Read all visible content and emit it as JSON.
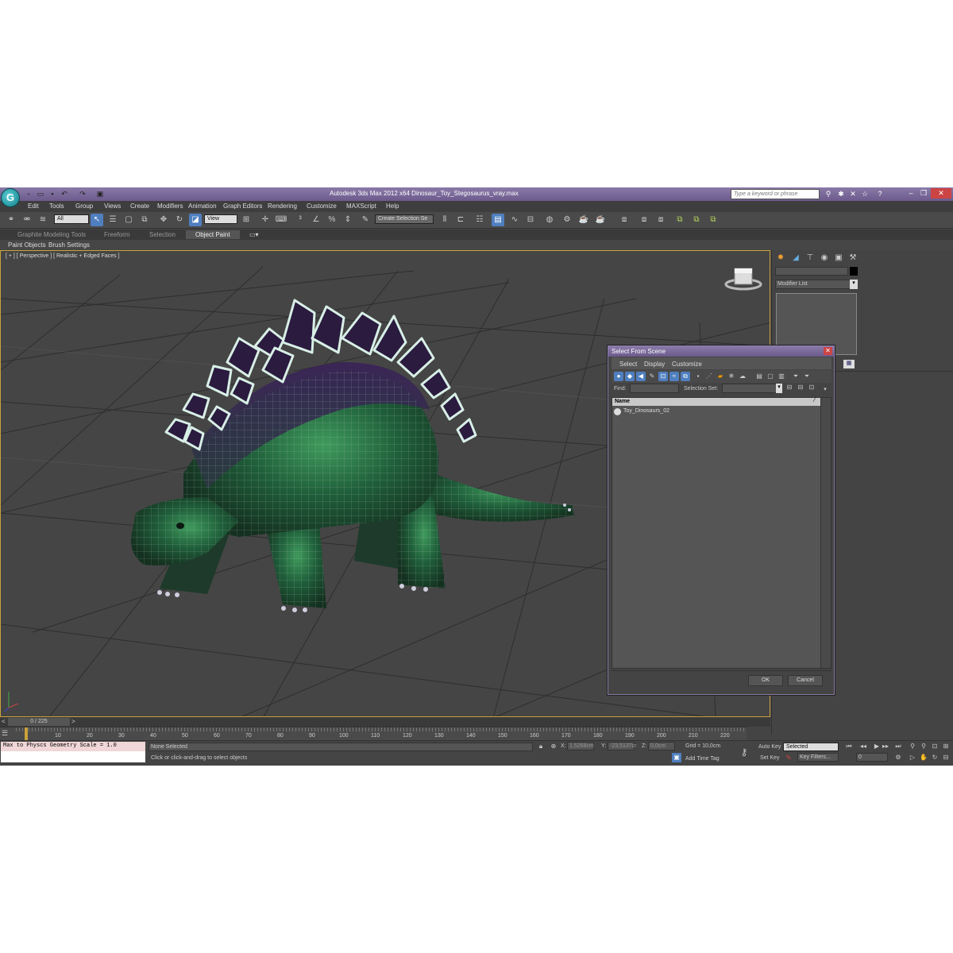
{
  "titlebar": {
    "app_title": "Autodesk 3ds Max  2012 x64     Dinosaur_Toy_Stegosaurus_vray.max",
    "search_placeholder": "Type a keyword or phrase"
  },
  "menu": [
    "Edit",
    "Tools",
    "Group",
    "Views",
    "Create",
    "Modifiers",
    "Animation",
    "Graph Editors",
    "Rendering",
    "Customize",
    "MAXScript",
    "Help"
  ],
  "toolbar": {
    "filter_value": "All",
    "ref_coord_value": "View",
    "selection_set_placeholder": "Create Selection Se"
  },
  "ribbon": {
    "tabs": [
      "Graphite Modeling Tools",
      "Freeform",
      "Selection",
      "Object Paint"
    ],
    "subtabs": [
      "Paint Objects",
      "Brush Settings"
    ]
  },
  "viewport": {
    "label": "[ + ] [ Perspective ] [ Realistic + Edged Faces ]"
  },
  "command_panel": {
    "modifier_list": "Modifier List"
  },
  "dialog": {
    "title": "Select From Scene",
    "menus": [
      "Select",
      "Display",
      "Customize"
    ],
    "find_label": "Find:",
    "selection_set_label": "Selection Set:",
    "column_name": "Name",
    "items": [
      "Toy_Dinosaurs_02"
    ],
    "ok": "OK",
    "cancel": "Cancel"
  },
  "timeline": {
    "frame": "0 / 225",
    "ticks": [
      "10",
      "20",
      "30",
      "40",
      "50",
      "60",
      "70",
      "80",
      "90",
      "100",
      "110",
      "120",
      "130",
      "140",
      "150",
      "160",
      "170",
      "180",
      "190",
      "200",
      "210",
      "220"
    ]
  },
  "status": {
    "maxscript_line": "Max to Physcs Geometry Scale = 1.0",
    "selection": "None Selected",
    "prompt": "Click or click-and-drag to select objects",
    "x_label": "X:",
    "x_value": "1,5268cm",
    "y_label": "Y:",
    "y_value": "-23,5137cr",
    "z_label": "Z:",
    "z_value": "0,0cm",
    "grid": "Grid = 10,0cm",
    "add_time_tag": "Add Time Tag",
    "auto_key": "Auto Key",
    "set_key": "Set Key",
    "key_mode": "Selected",
    "key_filters": "Key Filters...",
    "current_frame": "0"
  },
  "colors": {
    "titlebar": "#7a6a9a",
    "viewport_border": "#c8a23c",
    "active_tool": "#4f7fbf"
  }
}
